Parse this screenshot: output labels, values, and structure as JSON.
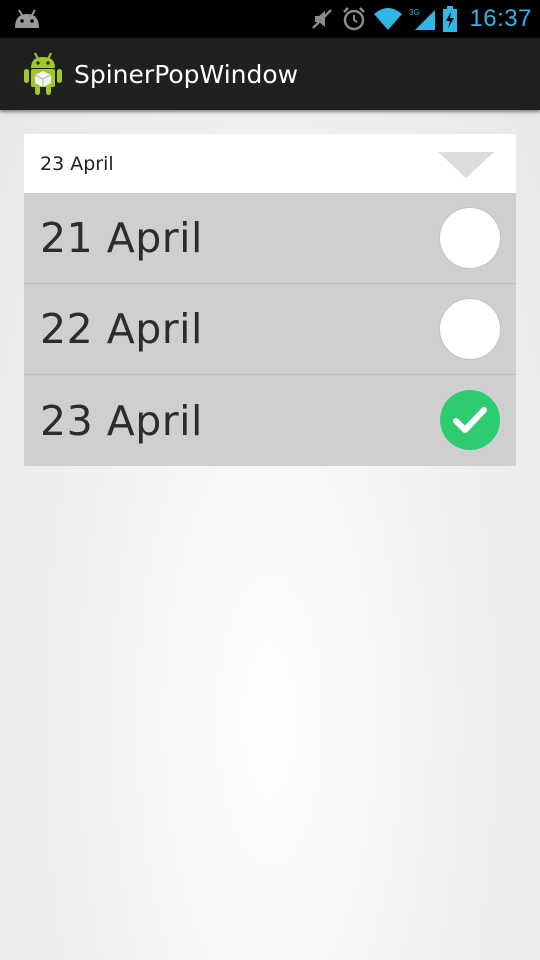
{
  "status_bar": {
    "time": "16:37",
    "icons": [
      "android-notification-icon",
      "mute-icon",
      "alarm-icon",
      "wifi-icon",
      "signal-3g-icon",
      "battery-charging-icon"
    ],
    "network_label": "3G",
    "accent_color": "#33b5e5"
  },
  "action_bar": {
    "title": "SpinerPopWindow",
    "app_icon": "android-app-icon"
  },
  "spinner": {
    "selected_value": "23 April",
    "arrow_icon": "dropdown-arrow-icon"
  },
  "popup": {
    "items": [
      {
        "label": "21 April",
        "checked": false
      },
      {
        "label": "22 April",
        "checked": false
      },
      {
        "label": "23 April",
        "checked": true
      }
    ],
    "check_color": "#2ecc71"
  }
}
